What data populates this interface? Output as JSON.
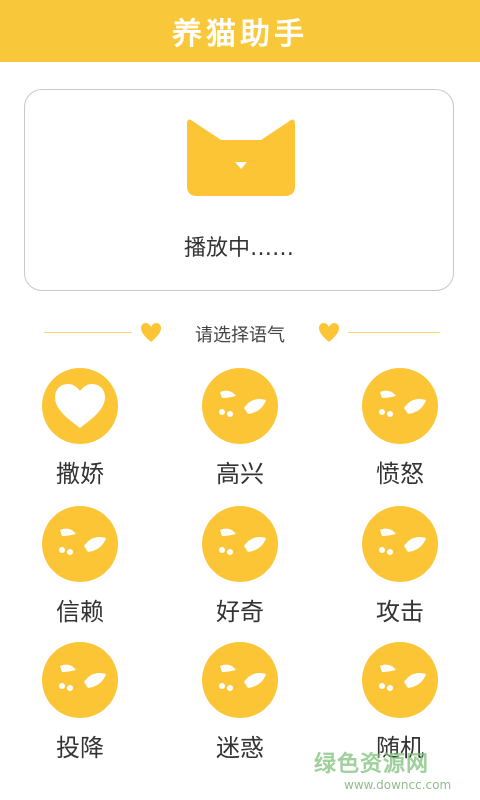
{
  "header": {
    "title": "养猫助手"
  },
  "player": {
    "icon": "cat-face-icon",
    "status": "播放中……"
  },
  "section": {
    "title": "请选择语气"
  },
  "moods": [
    {
      "label": "撒娇",
      "icon": "heart-icon"
    },
    {
      "label": "高兴",
      "icon": "cat-paw-face-icon"
    },
    {
      "label": "愤怒",
      "icon": "cat-paw-face-icon"
    },
    {
      "label": "信赖",
      "icon": "cat-paw-face-icon"
    },
    {
      "label": "好奇",
      "icon": "cat-paw-face-icon"
    },
    {
      "label": "攻击",
      "icon": "cat-paw-face-icon"
    },
    {
      "label": "投降",
      "icon": "cat-paw-face-icon"
    },
    {
      "label": "迷惑",
      "icon": "cat-paw-face-icon"
    },
    {
      "label": "随机",
      "icon": "cat-paw-face-icon"
    }
  ],
  "watermark": {
    "name": "绿色资源网",
    "url": "www.downcc.com"
  },
  "colors": {
    "accent": "#f9c83a",
    "badge": "#fbc535",
    "divider": "#f5d67a"
  }
}
